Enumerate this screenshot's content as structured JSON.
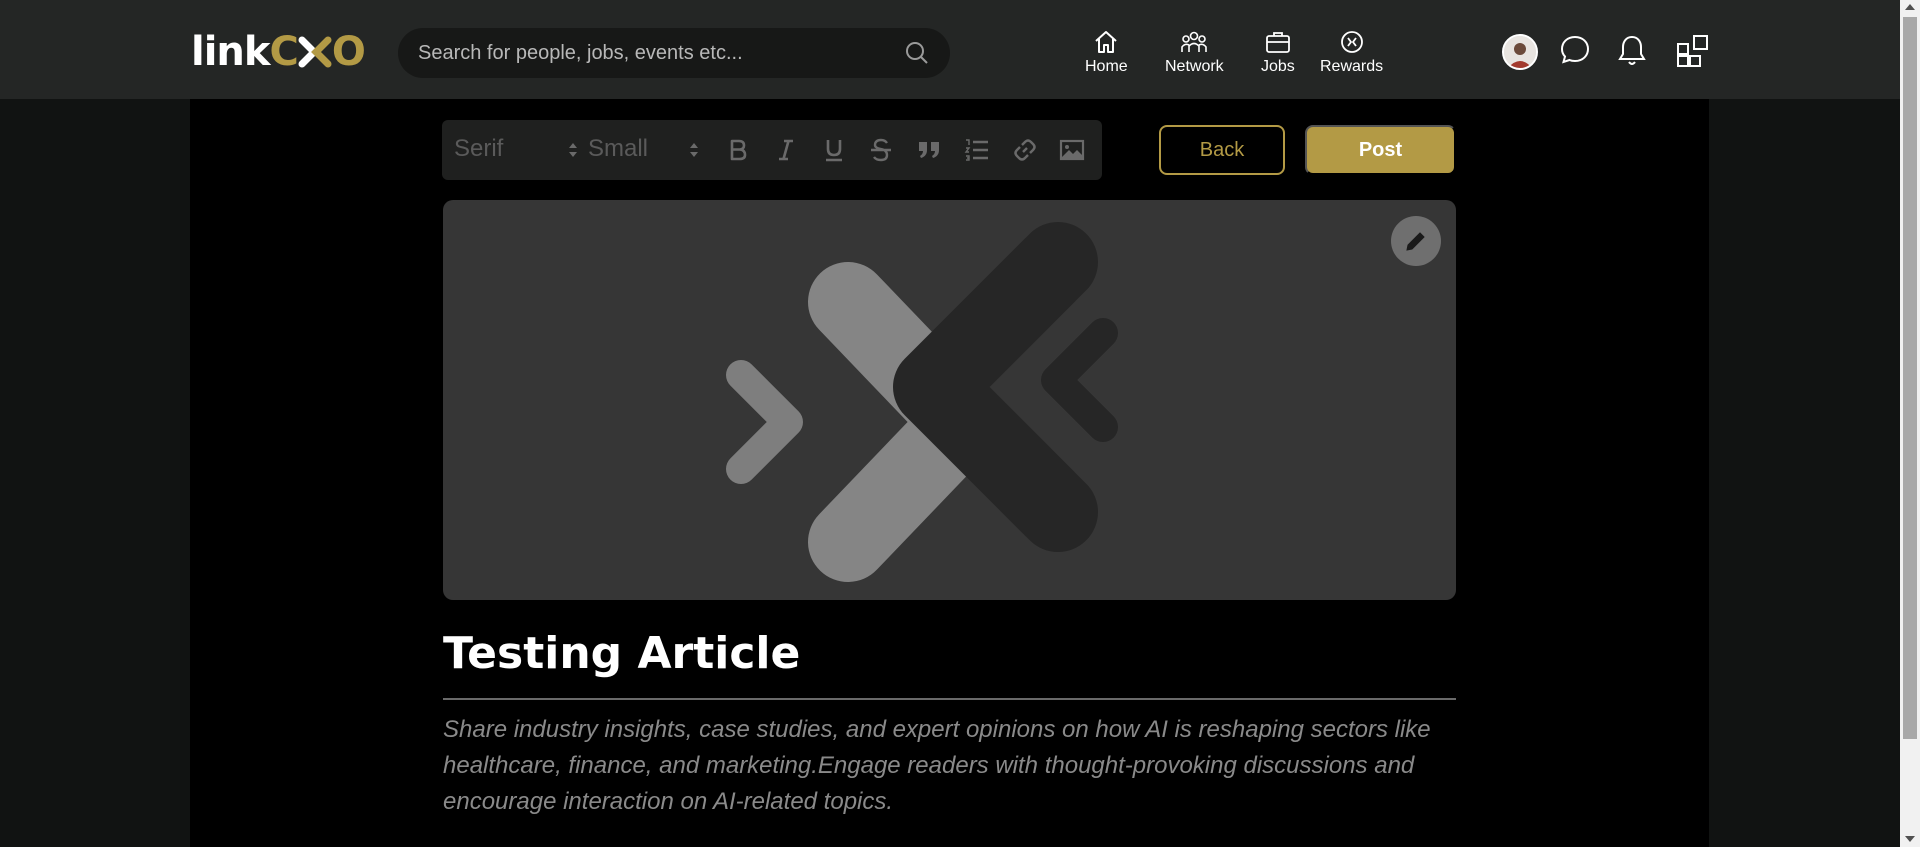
{
  "header": {
    "logo": {
      "part1": "link",
      "part2": "C",
      "part3": "O"
    },
    "search": {
      "placeholder": "Search for people, jobs, events etc..."
    },
    "nav": [
      {
        "label": "Home",
        "icon": "home-icon"
      },
      {
        "label": "Network",
        "icon": "network-icon"
      },
      {
        "label": "Jobs",
        "icon": "briefcase-icon"
      },
      {
        "label": "Rewards",
        "icon": "rewards-icon"
      }
    ],
    "right_icons": [
      "avatar",
      "chat-icon",
      "bell-icon",
      "apps-grid-icon"
    ]
  },
  "toolbar": {
    "font_select": "Serif",
    "size_select": "Small",
    "buttons": [
      "bold-icon",
      "italic-icon",
      "underline-icon",
      "strikethrough-icon",
      "quote-icon",
      "ordered-list-icon",
      "link-icon",
      "image-icon"
    ]
  },
  "actions": {
    "back_label": "Back",
    "post_label": "Post"
  },
  "article": {
    "title": "Testing Article",
    "description": "Share industry insights, case studies, and expert opinions on how AI is reshaping sectors like healthcare, finance, and marketing.Engage readers with thought-provoking discussions and encourage interaction on AI-related topics."
  },
  "colors": {
    "accent": "#b39a45",
    "navbar": "#242625",
    "background": "#000000",
    "cover": "#363636"
  }
}
